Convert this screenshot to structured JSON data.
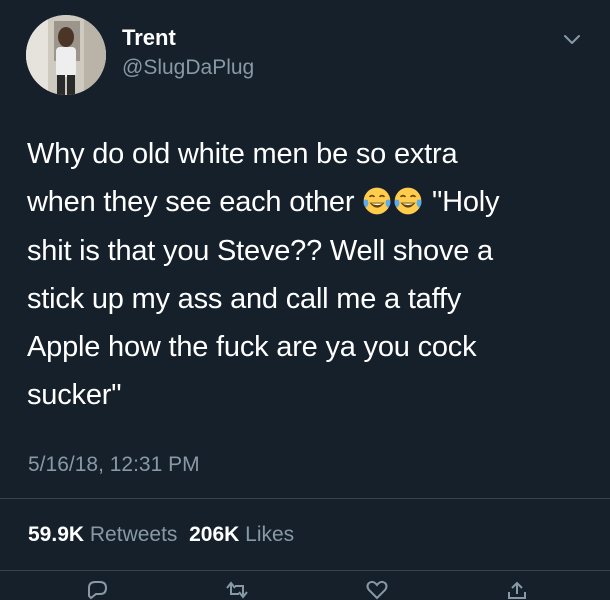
{
  "tweet": {
    "author": {
      "name": "Trent",
      "handle": "@SlugDaPlug"
    },
    "text_lines": [
      "Why do old white men be so extra",
      "when they see each other",
      "\"Holy",
      "shit is that you Steve?? Well shove a",
      "stick up my ass and call me a taffy",
      "Apple how the fuck are ya you cock",
      "sucker\""
    ],
    "emoji": [
      "face-with-tears-of-joy",
      "face-with-tears-of-joy"
    ],
    "timestamp": "5/16/18, 12:31 PM",
    "stats": {
      "retweets_count": "59.9K",
      "retweets_label": "Retweets",
      "likes_count": "206K",
      "likes_label": "Likes"
    }
  },
  "colors": {
    "background": "#15202b",
    "secondary_text": "#8899a6",
    "divider": "#38444d",
    "emoji_yellow": "#ffcc4d",
    "emoji_tears": "#5dadec"
  },
  "icons": [
    "chevron-down-icon",
    "reply-icon",
    "retweet-icon",
    "like-icon",
    "share-icon"
  ]
}
